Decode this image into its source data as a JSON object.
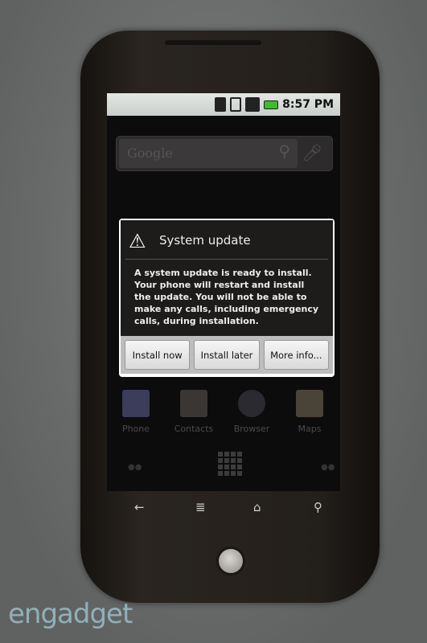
{
  "status_bar": {
    "time": "8:57 PM",
    "icons": [
      "wifi-icon",
      "sim-icon",
      "signal-icon",
      "battery-icon"
    ],
    "battery_color": "#3bbd2c"
  },
  "search": {
    "placeholder": "Google"
  },
  "dialog": {
    "title": "System update",
    "message": "A system update is ready to install. Your phone will restart and install the update. You will not be able to make any calls, including emergency calls, during installation.",
    "buttons": [
      "Install now",
      "Install later",
      "More info..."
    ]
  },
  "dock": [
    {
      "label": "Phone"
    },
    {
      "label": "Contacts"
    },
    {
      "label": "Browser"
    },
    {
      "label": "Maps"
    }
  ],
  "nav": {
    "back": "←",
    "menu": "≣",
    "home": "⌂",
    "search": "⚲"
  },
  "watermark": "engadget"
}
